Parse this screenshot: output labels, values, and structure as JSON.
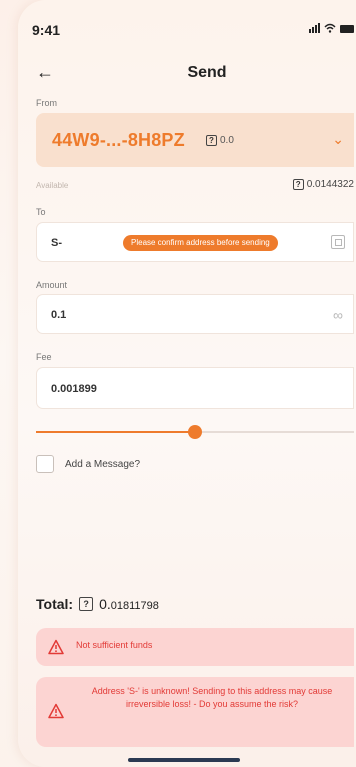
{
  "status": {
    "time": "9:41"
  },
  "header": {
    "title": "Send"
  },
  "from": {
    "label": "From",
    "address": "44W9-...-8H8PZ",
    "token_glyph": "?",
    "balance": "0.0"
  },
  "available": {
    "label": "Available",
    "token_glyph": "?",
    "value": "0.0144322"
  },
  "to": {
    "label": "To",
    "value": "S-",
    "warning": "Please confirm address before sending"
  },
  "amount": {
    "label": "Amount",
    "value": "0.1"
  },
  "fee": {
    "label": "Fee",
    "value": "0.001899",
    "slider_fraction": 0.5
  },
  "message": {
    "label": "Add a Message?"
  },
  "total": {
    "label": "Total:",
    "token_glyph": "?",
    "value_big": "0.",
    "value_small": "01811798"
  },
  "alerts": [
    {
      "text": "Not sufficient funds"
    },
    {
      "text": "Address 'S-' is unknown! Sending to this address may cause irreversible loss! - Do you assume the risk?"
    }
  ],
  "colors": {
    "accent": "#ee7b2c",
    "error": "#e23a36",
    "error_bg": "#fcd4d2"
  }
}
